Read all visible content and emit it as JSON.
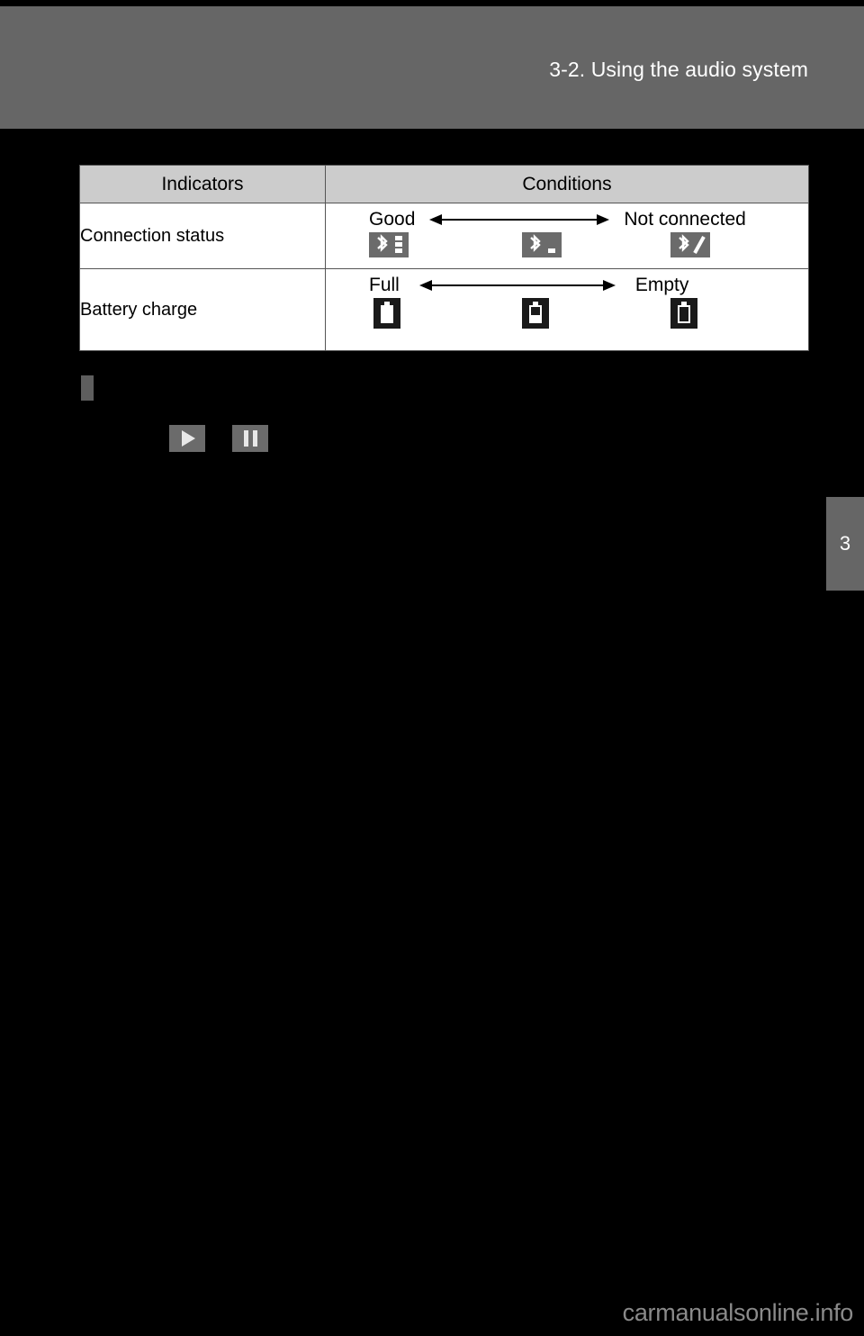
{
  "page": {
    "header_title": "3-2. Using the audio system",
    "chapter_number": "3",
    "watermark": "carmanualsonline.info"
  },
  "table": {
    "headers": [
      "Indicators",
      "Conditions"
    ],
    "rows": [
      {
        "indicator": "Connection status",
        "left_label": "Good",
        "right_label": "Not connected",
        "arrow": "double-headed-arrow",
        "icons": [
          {
            "name": "bluetooth-signal-strong-icon",
            "bars": 3,
            "slashed": false
          },
          {
            "name": "bluetooth-signal-weak-icon",
            "bars": 1,
            "slashed": false
          },
          {
            "name": "bluetooth-not-connected-icon",
            "bars": 0,
            "slashed": true
          }
        ]
      },
      {
        "indicator": "Battery charge",
        "left_label": "Full",
        "right_label": "Empty",
        "arrow": "double-headed-arrow",
        "icons": [
          {
            "name": "battery-full-icon",
            "level": 100
          },
          {
            "name": "battery-half-icon",
            "level": 45
          },
          {
            "name": "battery-empty-icon",
            "level": 0
          }
        ]
      }
    ]
  },
  "transport": {
    "buttons": [
      {
        "name": "play-button",
        "icon": "play-icon"
      },
      {
        "name": "pause-button",
        "icon": "pause-icon"
      }
    ]
  },
  "colors": {
    "header_band": "#666666",
    "page_background": "#000000",
    "table_header_fill": "#cccccc",
    "table_body_fill": "#ffffff",
    "icon_tile_gray": "#6b6b6b",
    "icon_tile_dark": "#1a1a1a",
    "watermark": "#8a8a8a"
  }
}
